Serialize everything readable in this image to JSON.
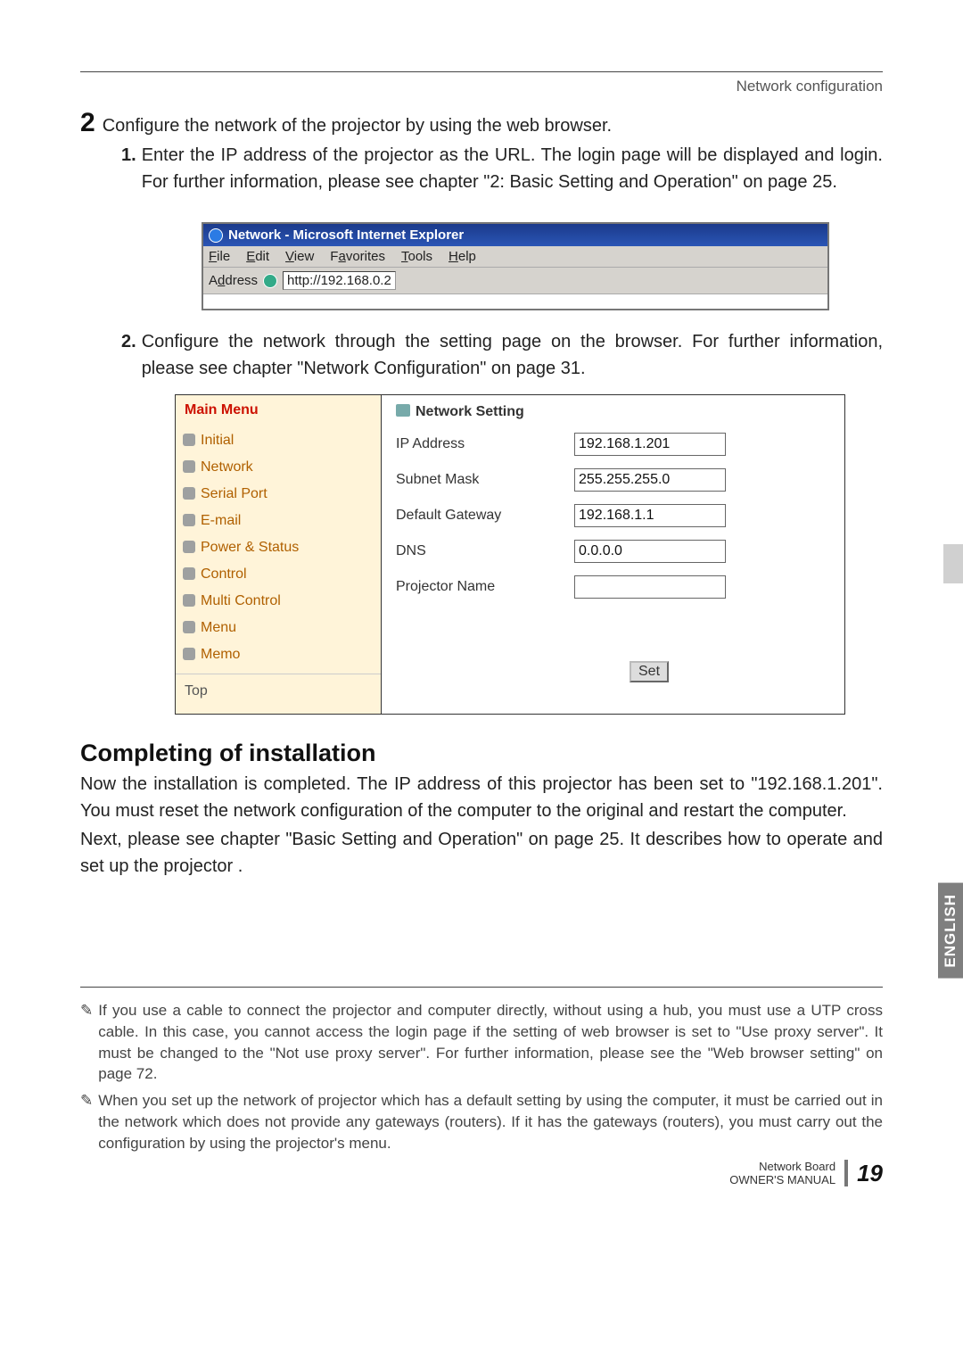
{
  "header": {
    "section": "Network configuration"
  },
  "step2": {
    "num": "2",
    "lead": "Configure the network of the projector by using the web browser.",
    "sub1_num": "1.",
    "sub1": "Enter the IP address of the projector as the URL. The login page will be displayed and login. For further information, please see chapter \"2: Basic Setting and Operation\" on page 25.",
    "sub2_num": "2.",
    "sub2": "Configure the network through the setting page on the browser. For further information, please see chapter \"Network Configuration\" on page 31."
  },
  "ie": {
    "title": "Network - Microsoft Internet Explorer",
    "menu": {
      "file": "File",
      "edit": "Edit",
      "view": "View",
      "fav": "Favorites",
      "tools": "Tools",
      "help": "Help",
      "u_f": "F",
      "u_e": "E",
      "u_v": "V",
      "u_a": "a",
      "u_t": "T",
      "u_h": "H"
    },
    "addr_label": "Address",
    "addr_ul": "A",
    "url": "http://192.168.0.2"
  },
  "net": {
    "main_menu": "Main Menu",
    "items": [
      "Initial",
      "Network",
      "Serial Port",
      "E-mail",
      "Power & Status",
      "Control",
      "Multi Control",
      "Menu",
      "Memo"
    ],
    "top": "Top",
    "title": "Network Setting",
    "rows": [
      {
        "label": "IP Address",
        "value": "192.168.1.201"
      },
      {
        "label": "Subnet Mask",
        "value": "255.255.255.0"
      },
      {
        "label": "Default Gateway",
        "value": "192.168.1.1"
      },
      {
        "label": "DNS",
        "value": "0.0.0.0"
      },
      {
        "label": "Projector Name",
        "value": ""
      }
    ],
    "set": "Set"
  },
  "completing": {
    "heading": "Completing of installation",
    "p1": "Now the installation is completed. The IP address of this projector has been set to \"192.168.1.201\". You must reset the network configuration of the computer to the original and restart the computer.",
    "p2": "Next, please see chapter \"Basic Setting and Operation\" on page 25. It describes how to operate and set up the projector ."
  },
  "sidetab": "ENGLISH",
  "footnotes": {
    "icon": "✎",
    "n1": "If you use a cable to connect the projector and computer directly, without using a hub, you must use a UTP cross cable. In this case, you cannot access the login page if the setting of web browser is set to \"Use proxy server\". It must be changed to the \"Not use proxy server\". For further information, please see the \"Web browser setting\" on page 72.",
    "n2": "When you set up the network of projector which has a default setting by using the computer, it must be carried out in the network which does not provide any gateways (routers). If it has the gateways (routers), you must carry out the configuration by using the projector's menu."
  },
  "footer": {
    "line1": "Network Board",
    "line2": "OWNER'S MANUAL",
    "page": "19"
  }
}
